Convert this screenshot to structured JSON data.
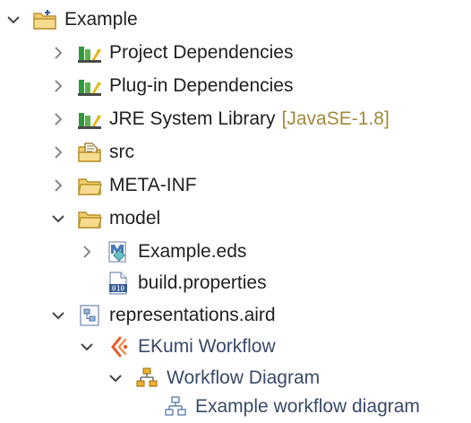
{
  "tree": {
    "items": [
      {
        "label": "Example",
        "icon": "project-folder-icon",
        "state": "expanded"
      },
      {
        "label": "Project Dependencies",
        "icon": "library-icon",
        "state": "collapsed"
      },
      {
        "label": "Plug-in Dependencies",
        "icon": "library-icon",
        "state": "collapsed"
      },
      {
        "label": "JRE System Library",
        "decoration": "[JavaSE-1.8]",
        "icon": "library-icon",
        "state": "collapsed"
      },
      {
        "label": "src",
        "icon": "source-folder-icon",
        "state": "collapsed"
      },
      {
        "label": "META-INF",
        "icon": "folder-icon",
        "state": "collapsed"
      },
      {
        "label": "model",
        "icon": "folder-icon",
        "state": "expanded"
      },
      {
        "label": "Example.eds",
        "icon": "ecore-model-icon",
        "state": "collapsed"
      },
      {
        "label": "build.properties",
        "icon": "properties-file-icon",
        "state": "leaf"
      },
      {
        "label": "representations.aird",
        "icon": "aird-file-icon",
        "state": "expanded"
      },
      {
        "label": "EKumi Workflow",
        "icon": "viewpoint-icon",
        "state": "expanded"
      },
      {
        "label": "Workflow Diagram",
        "icon": "diagram-type-icon",
        "state": "expanded"
      },
      {
        "label": "Example workflow diagram",
        "icon": "diagram-icon",
        "state": "leaf"
      }
    ]
  },
  "colors": {
    "accent": "#4a7ab8",
    "folder": "#f2cc6e",
    "library_green": "#2e9a3a",
    "decoration": "#a08a3c",
    "viewpoint": "#e85a2a"
  }
}
